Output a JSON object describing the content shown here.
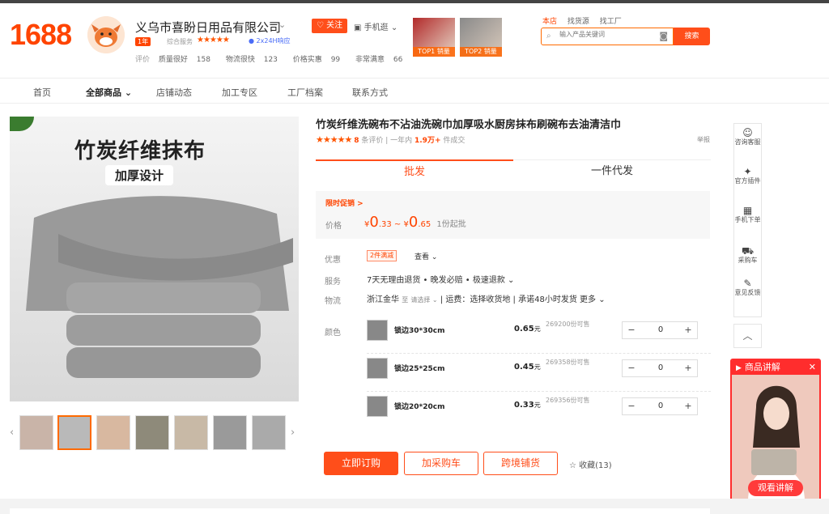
{
  "logo": "1688",
  "shop": {
    "name": "义乌市喜盼日用品有限公司",
    "follow_label": "关注",
    "mobile_label": "手机逛",
    "years_badge": "1年",
    "service_label": "综合服务",
    "stars": "★★★★★",
    "response": "2x24H响应",
    "metrics": [
      {
        "label": "评价",
        "value": ""
      },
      {
        "label": "质量很好",
        "value": "158"
      },
      {
        "label": "物流很快",
        "value": "123"
      },
      {
        "label": "价格实惠",
        "value": "99"
      },
      {
        "label": "非常满意",
        "value": "66"
      }
    ],
    "top_products": [
      {
        "label": "TOP1 销量",
        "color": "#c0392b"
      },
      {
        "label": "TOP2 销量",
        "color": "#7f8c8d"
      }
    ]
  },
  "search": {
    "tabs": [
      "本店",
      "找货源",
      "找工厂"
    ],
    "placeholder": "输入产品关键词",
    "button": "搜索"
  },
  "nav": [
    "首页",
    "全部商品",
    "店铺动态",
    "加工专区",
    "工厂档案",
    "联系方式"
  ],
  "gallery": {
    "headline": "竹炭纤维抹布",
    "subline": "加厚设计"
  },
  "product": {
    "title": "竹炭纤维洗碗布不沾油洗碗巾加厚吸水厨房抹布刷碗布去油清洁巾",
    "stars": "★★★★★",
    "reviews_count": "8",
    "reviews_label": "条评价",
    "sold_prefix": "一年内",
    "sold_count": "1.9万+",
    "sold_suffix": "件成交",
    "report": "举报",
    "tab_wholesale": "批发",
    "tab_dropship": "一件代发",
    "promo": "限时促销 >",
    "price_label": "价格",
    "price_low_int": "0",
    "price_low_dec": ".33",
    "price_high_int": "0",
    "price_high_dec": ".65",
    "currency": "¥",
    "price_sep": "~",
    "moq": "1份起批",
    "discount_label": "优惠",
    "coupon": "2件满减",
    "coupon_more": "查看 ⌄",
    "service_label": "服务",
    "service": "7天无理由退货 • 晚发必赔 • 极速退款 ⌄",
    "logistics_label": "物流",
    "origin": "浙江金华",
    "to": "至",
    "to_select": "请选择 ⌄",
    "shipping": "运费：选择收货地",
    "promise": "承诺48小时发货",
    "more": "更多 ⌄",
    "color_label": "颜色",
    "colors": [
      {
        "name": "锁边30*30cm",
        "price": "0.65",
        "stock": "269200份可售",
        "qty": "0"
      },
      {
        "name": "锁边25*25cm",
        "price": "0.45",
        "stock": "269358份可售",
        "qty": "0"
      },
      {
        "name": "锁边20*20cm",
        "price": "0.33",
        "stock": "269356份可售",
        "qty": "0"
      }
    ],
    "yuan": "元",
    "buy": "立即订购",
    "cart": "加采购车",
    "cross": "跨境铺货",
    "fav": "☆ 收藏(13)"
  },
  "side": [
    {
      "icon": "☺",
      "label": "咨询客服",
      "name": "consult-service"
    },
    {
      "icon": "✦",
      "label": "官方插件",
      "name": "official-plugin"
    },
    {
      "icon": "▦",
      "label": "手机下单",
      "name": "mobile-order"
    },
    {
      "icon": "⛟",
      "label": "采购车",
      "name": "purchase-cart"
    },
    {
      "icon": "✎",
      "label": "意见反馈",
      "name": "feedback"
    }
  ],
  "live": {
    "title": "商品讲解",
    "watch": "观看讲解"
  },
  "colors": {
    "accent": "#ff4e1a",
    "price": "#ff4400"
  }
}
